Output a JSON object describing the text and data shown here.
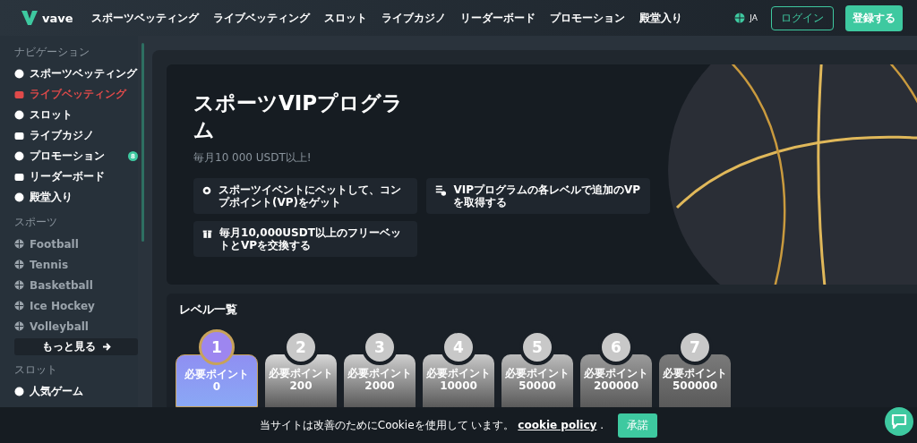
{
  "header": {
    "logo": "vave",
    "nav": [
      "スポーツベッティング",
      "ライブベッティング",
      "スロット",
      "ライブカジノ",
      "リーダーボード",
      "プロモーション",
      "殿堂入り"
    ],
    "language": "JA",
    "login": "ログイン",
    "register": "登録する"
  },
  "sidebar": {
    "sections": [
      {
        "title": "ナビゲーション",
        "kind": "nav",
        "items": [
          {
            "label": "スポーツベッティング",
            "selected": false
          },
          {
            "label": "ライブベッティング",
            "selected": true
          },
          {
            "label": "スロット",
            "selected": false
          },
          {
            "label": "ライブカジノ",
            "selected": false
          },
          {
            "label": "プロモーション",
            "selected": false,
            "badge": "8"
          },
          {
            "label": "リーダーボード",
            "selected": false
          },
          {
            "label": "殿堂入り",
            "selected": false
          }
        ]
      },
      {
        "title": "スポーツ",
        "kind": "sports",
        "items": [
          {
            "label": "Football",
            "selected": false
          },
          {
            "label": "Tennis",
            "selected": false
          },
          {
            "label": "Basketball",
            "selected": false
          },
          {
            "label": "Ice Hockey",
            "selected": false
          },
          {
            "label": "Volleyball",
            "selected": false
          }
        ],
        "more": "もっと見る"
      },
      {
        "title": "スロット",
        "kind": "nav",
        "items": [
          {
            "label": "人気ゲーム",
            "selected": false
          }
        ]
      }
    ]
  },
  "hero": {
    "title": "スポーツVIPプログラム",
    "subtitle": "毎月10 000 USDT以上!",
    "features": [
      "スポーツイベントにベットして、コンプポイント(VP)をゲット",
      "VIPプログラムの各レベルで追加のVPを取得する",
      "毎月10,000USDT以上のフリーベットとVPを交換する"
    ]
  },
  "levels": {
    "title": "レベル一覧",
    "items": [
      {
        "number": "1",
        "label": "必要ポイント",
        "points": "0",
        "selected": true
      },
      {
        "number": "2",
        "label": "必要ポイント",
        "points": "200",
        "selected": false
      },
      {
        "number": "3",
        "label": "必要ポイント",
        "points": "2000",
        "selected": false
      },
      {
        "number": "4",
        "label": "必要ポイント",
        "points": "10000",
        "selected": false
      },
      {
        "number": "5",
        "label": "必要ポイント",
        "points": "50000",
        "selected": false
      },
      {
        "number": "6",
        "label": "必要ポイント",
        "points": "200000",
        "selected": false
      },
      {
        "number": "7",
        "label": "必要ポイント",
        "points": "500000",
        "selected": false
      }
    ]
  },
  "cookie_bar": {
    "text": "当サイトは改善のためにCookieを使用して います。",
    "link": "cookie policy",
    "link_suffix": ".",
    "accept": "承諾"
  }
}
